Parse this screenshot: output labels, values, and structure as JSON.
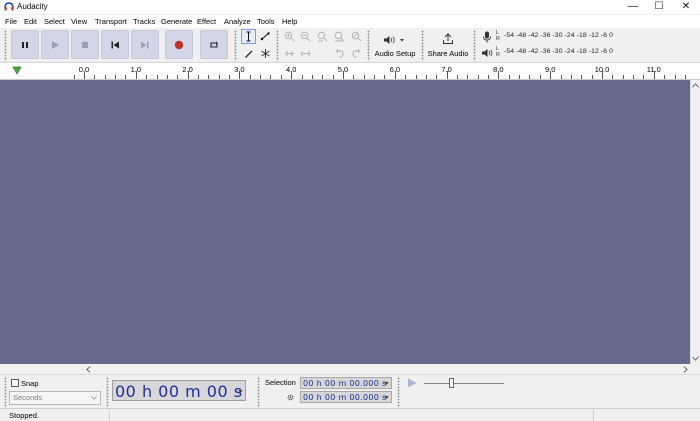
{
  "window": {
    "title": "Audacity",
    "controls": {
      "minimize": "—",
      "maximize": "☐",
      "close": "✕"
    }
  },
  "menu": [
    "File",
    "Edit",
    "Select",
    "View",
    "Transport",
    "Tracks",
    "Generate",
    "Effect",
    "Analyze",
    "Tools",
    "Help"
  ],
  "toolbar": {
    "audio_setup_label": "Audio Setup",
    "share_audio_label": "Share Audio",
    "meter_scale": "-54  -48  -42  -36  -30  -24  -18  -12   -6    0",
    "rec_meter_lr": "L\nR",
    "play_meter_lr": "L\nR"
  },
  "ruler": {
    "labels": [
      "0.0",
      "1.0",
      "2.0",
      "3.0",
      "4.0",
      "5.0",
      "6.0",
      "7.0",
      "8.0",
      "9.0",
      "10.0",
      "11.0"
    ]
  },
  "bottom": {
    "snap_label": "Snap",
    "snap_checked": false,
    "snap_units": "Seconds",
    "time_display": "00 h 00 m 00 s",
    "selection_label": "Selection",
    "selection_start": "00 h 00 m 00.000 s",
    "selection_end": "00 h 00 m 00.000 s"
  },
  "status": {
    "text": "Stopped."
  },
  "colors": {
    "track_background": "#666a8a",
    "time_digits": "#1a2fa0",
    "record_red": "#c0302a"
  }
}
